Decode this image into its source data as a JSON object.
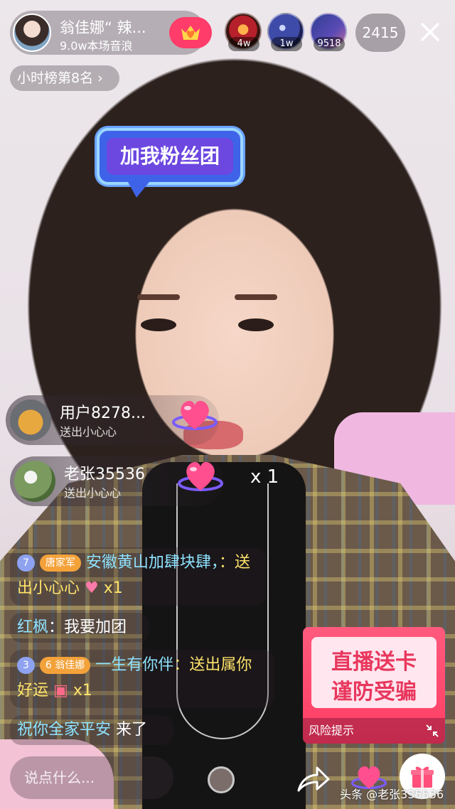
{
  "header": {
    "host_name": "翁佳娜“ 辣...",
    "host_sub": "9.0w本场音浪",
    "viewer_counts": [
      "4w",
      "1w",
      "9518"
    ],
    "audience_count": "2415",
    "rank": "小时榜第8名 ›"
  },
  "bubble": {
    "text": "加我粉丝团"
  },
  "gifts": [
    {
      "user": "用户8278...",
      "action": "送出小心心"
    },
    {
      "user": "老张35536",
      "action": "送出小心心",
      "multiplier": "x 1"
    }
  ],
  "chat": [
    {
      "level": "7",
      "fan_badge": "唐家军",
      "name": "安徽黄山加肆块肆，",
      "text": "：送出小心心",
      "mult": "x1"
    },
    {
      "name": "红枫",
      "text": "：我要加团"
    },
    {
      "level": "3",
      "fan_badge": "翁佳娜",
      "fan_level": "6",
      "name": "一生有你伴",
      "text": "：送出属你好运",
      "mult": "x1"
    },
    {
      "name": "祝你全家平安",
      "text": " 来了"
    }
  ],
  "promo": {
    "line1": "直播送卡",
    "line2": "谨防受骗",
    "footer": "风险提示"
  },
  "input": {
    "placeholder": "说点什么..."
  },
  "watermark": "头条 @老张335536",
  "colors": {
    "accent": "#ff3c6a",
    "chat_cyan": "#8fe3ff",
    "chat_yellow": "#ffe36b"
  }
}
